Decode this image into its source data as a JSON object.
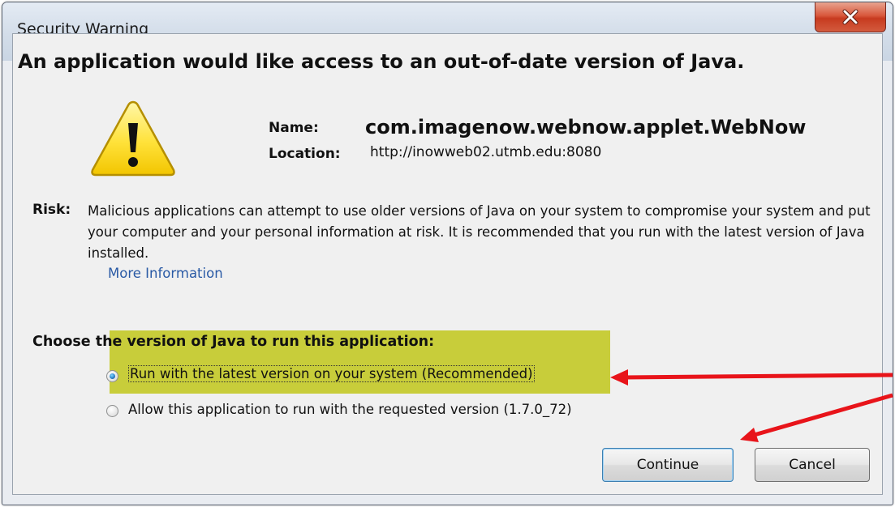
{
  "window": {
    "title": "Security Warning"
  },
  "dialog": {
    "headline": "An application would like access to an out-of-date version of Java.",
    "name_label": "Name:",
    "name_value": "com.imagenow.webnow.applet.WebNow",
    "location_label": "Location:",
    "location_value": "http://inowweb02.utmb.edu:8080",
    "risk_label": "Risk:",
    "risk_text": "Malicious applications can attempt to use older versions of Java on your system to compromise your system and put your computer and your personal information at risk. It is recommended that you run with the latest version of Java installed.",
    "more_info_link": "More Information",
    "choose_prefix": "Choose",
    "choose_highlighted": "the version of Java to run this application:",
    "options": [
      {
        "label": "Run with the latest version on your system (Recommended)",
        "selected": true
      },
      {
        "label": "Allow this application to run with the requested version (1.7.0_72)",
        "selected": false
      }
    ],
    "buttons": {
      "continue": "Continue",
      "cancel": "Cancel"
    }
  },
  "colors": {
    "highlight": "#c8cd3a",
    "annotation_arrow": "#e8141a",
    "link": "#2a5aa5",
    "close_button": "#c73a1f"
  },
  "icons": {
    "close": "close-icon",
    "warning": "warning-icon"
  }
}
